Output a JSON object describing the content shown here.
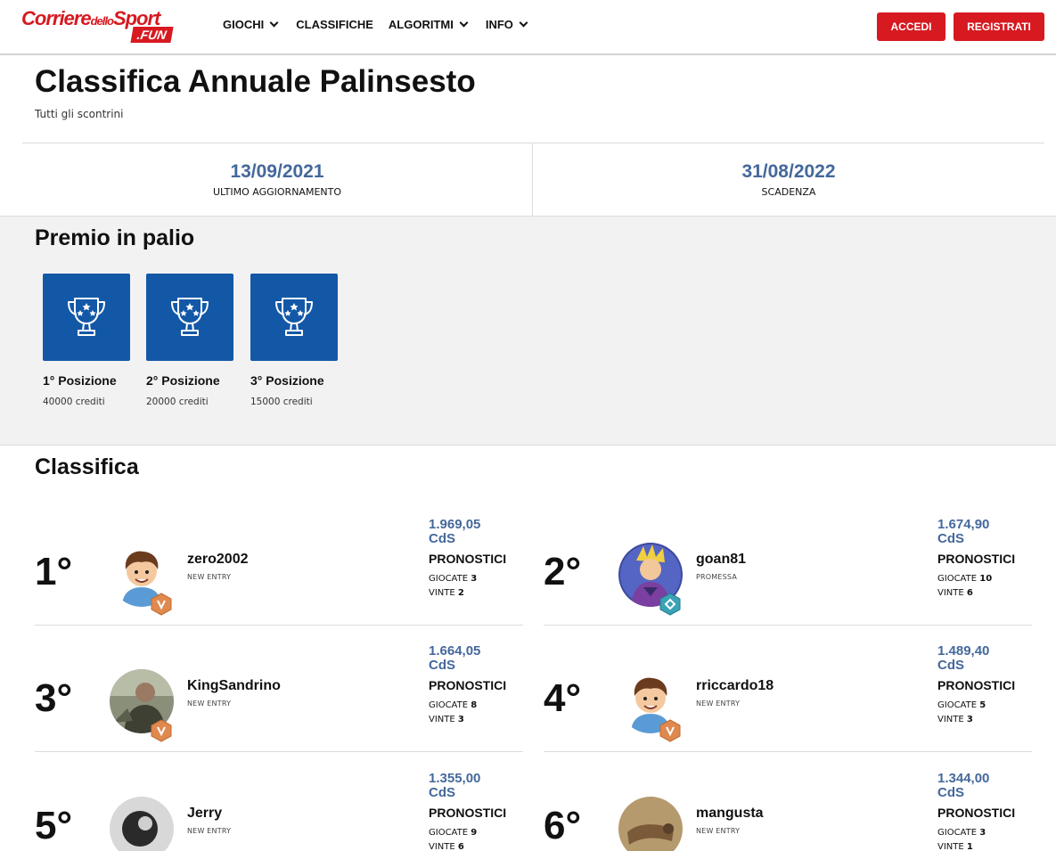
{
  "header": {
    "logo_main": "Corriere",
    "logo_small": "dello",
    "logo_sport": "Sport",
    "logo_fun": ".FUN",
    "nav": [
      {
        "label": "GIOCHI",
        "dropdown": true
      },
      {
        "label": "CLASSIFICHE",
        "dropdown": false
      },
      {
        "label": "ALGORITMI",
        "dropdown": true
      },
      {
        "label": "INFO",
        "dropdown": true
      }
    ],
    "login_label": "ACCEDI",
    "register_label": "REGISTRATI"
  },
  "page": {
    "title": "Classifica Annuale Palinsesto",
    "subtitle": "Tutti gli scontrini"
  },
  "dates": {
    "updated_value": "13/09/2021",
    "updated_label": "ULTIMO AGGIORNAMENTO",
    "expiry_value": "31/08/2022",
    "expiry_label": "SCADENZA"
  },
  "prizes": {
    "title": "Premio in palio",
    "items": [
      {
        "position": "1° Posizione",
        "credits": "40000 crediti"
      },
      {
        "position": "2° Posizione",
        "credits": "20000 crediti"
      },
      {
        "position": "3° Posizione",
        "credits": "15000 crediti"
      }
    ]
  },
  "ranking": {
    "title": "Classifica",
    "pron_label": "PRONOSTICI",
    "played_label": "GIOCATE",
    "won_label": "VINTE",
    "entries": [
      {
        "pos": "1°",
        "name": "zero2002",
        "level": "NEW ENTRY",
        "score": "1.969,05",
        "currency": "CdS",
        "played": "3",
        "won": "2",
        "avatar": "cartoon-boy"
      },
      {
        "pos": "2°",
        "name": "goan81",
        "level": "PROMESSA",
        "score": "1.674,90",
        "currency": "CdS",
        "played": "10",
        "won": "6",
        "avatar": "anime-warrior"
      },
      {
        "pos": "3°",
        "name": "KingSandrino",
        "level": "NEW ENTRY",
        "score": "1.664,05",
        "currency": "CdS",
        "played": "8",
        "won": "3",
        "avatar": "photo"
      },
      {
        "pos": "4°",
        "name": "rriccardo18",
        "level": "NEW ENTRY",
        "score": "1.489,40",
        "currency": "CdS",
        "played": "5",
        "won": "3",
        "avatar": "cartoon-boy"
      },
      {
        "pos": "5°",
        "name": "Jerry",
        "level": "NEW ENTRY",
        "score": "1.355,00",
        "currency": "CdS",
        "played": "9",
        "won": "6",
        "avatar": "photo-dark"
      },
      {
        "pos": "6°",
        "name": "mangusta",
        "level": "NEW ENTRY",
        "score": "1.344,00",
        "currency": "CdS",
        "played": "3",
        "won": "1",
        "avatar": "photo-animal"
      }
    ]
  },
  "colors": {
    "brand_red": "#d71920",
    "accent_blue": "#44689b",
    "prize_blue": "#1358a7"
  }
}
